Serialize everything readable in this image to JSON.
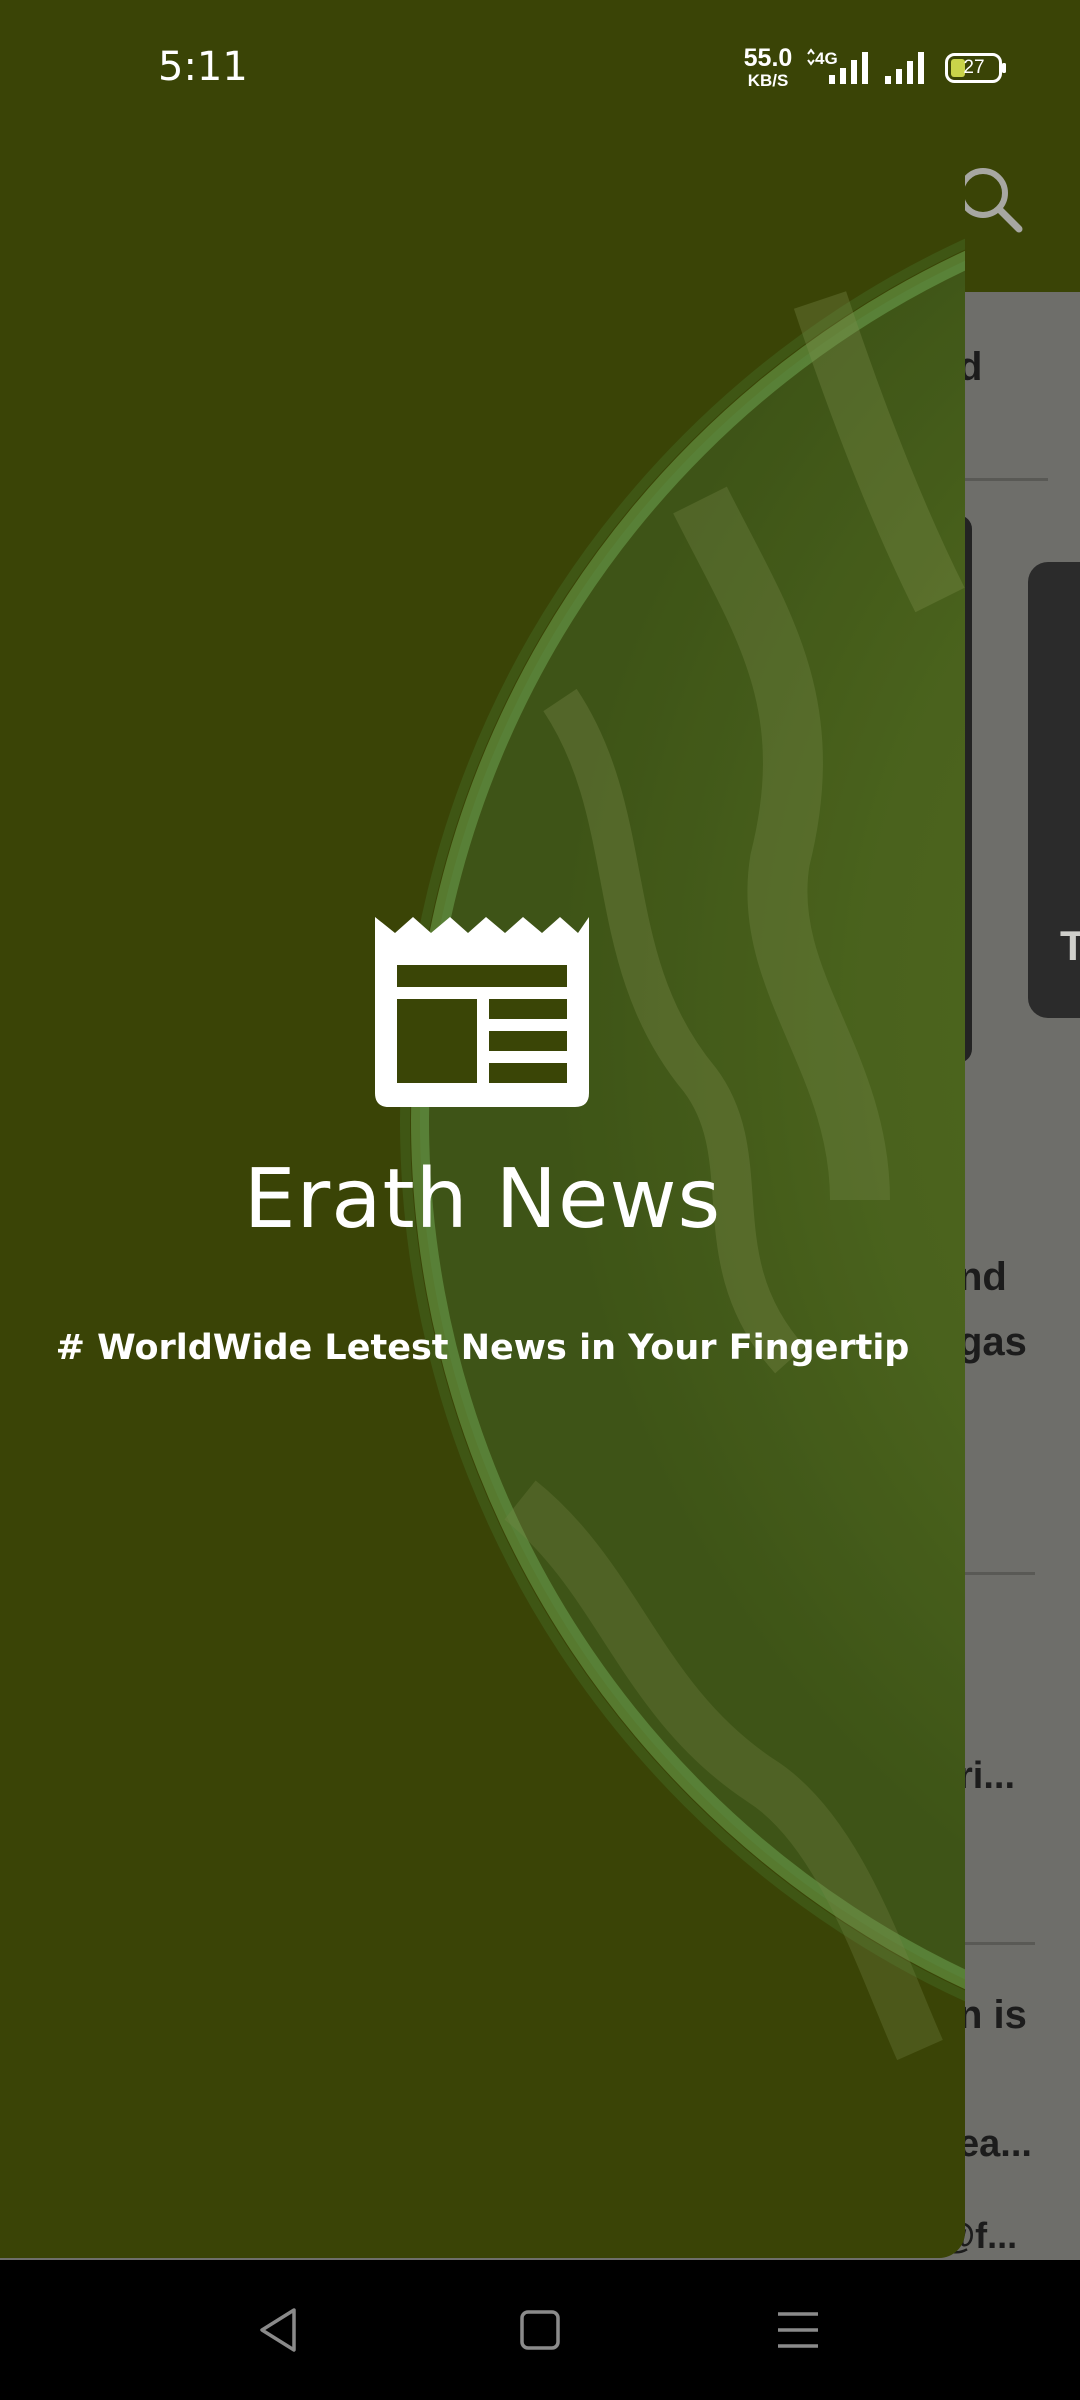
{
  "status_bar": {
    "time": "5:11",
    "net_speed_value": "55.0",
    "net_speed_unit": "KB/S",
    "network_type": "4G",
    "battery_level": "27"
  },
  "drawer": {
    "app_title": "Erath News",
    "tagline": "# WorldWide Letest News in Your Fingertip",
    "logo_icon": "newspaper-icon"
  },
  "background_page": {
    "snippets": [
      "d",
      "nd",
      "gas",
      "ri...",
      "n is",
      "ea...",
      "@f...",
      "T"
    ]
  },
  "nav_bar": {
    "back": "back-icon",
    "home": "home-icon",
    "recents": "menu-icon"
  },
  "colors": {
    "drawer_background": "#3a4506",
    "header_background": "#3a4406",
    "nav_bar": "#000000",
    "text": "#ffffff"
  }
}
